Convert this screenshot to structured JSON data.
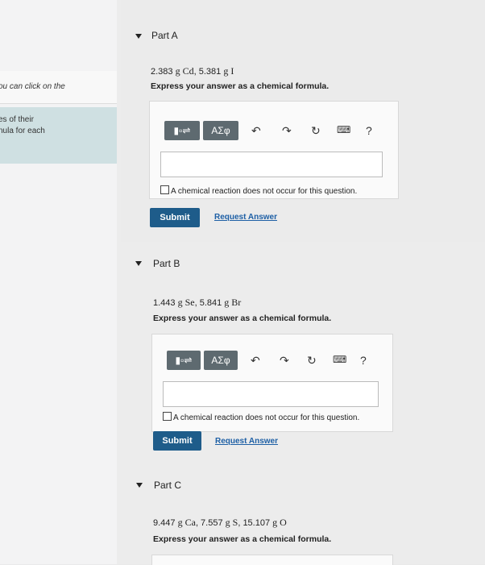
{
  "sidebar": {
    "hint1": "ou can click on the",
    "hint2_line1": "es of their",
    "hint2_line2": "nula for each"
  },
  "parts": [
    {
      "title": "Part A",
      "question_parts": [
        "2.383",
        "g Cd",
        ", 5.381",
        "g I"
      ],
      "instruction": "Express your answer as a chemical formula.",
      "symbols_label": "ΑΣφ",
      "help_label": "?",
      "no_reaction_label": "A chemical reaction does not occur for this question.",
      "submit_label": "Submit",
      "request_label": "Request Answer"
    },
    {
      "title": "Part B",
      "question_parts": [
        "1.443",
        "g Se",
        ", 5.841",
        "g Br"
      ],
      "instruction": "Express your answer as a chemical formula.",
      "symbols_label": "ΑΣφ",
      "help_label": "?",
      "no_reaction_label": "A chemical reaction does not occur for this question.",
      "submit_label": "Submit",
      "request_label": "Request Answer"
    },
    {
      "title": "Part C",
      "question_parts": [
        "9.447",
        "g Ca",
        ", 7.557",
        "g S",
        ", 15.107",
        "g O"
      ],
      "instruction": "Express your answer as a chemical formula."
    }
  ]
}
